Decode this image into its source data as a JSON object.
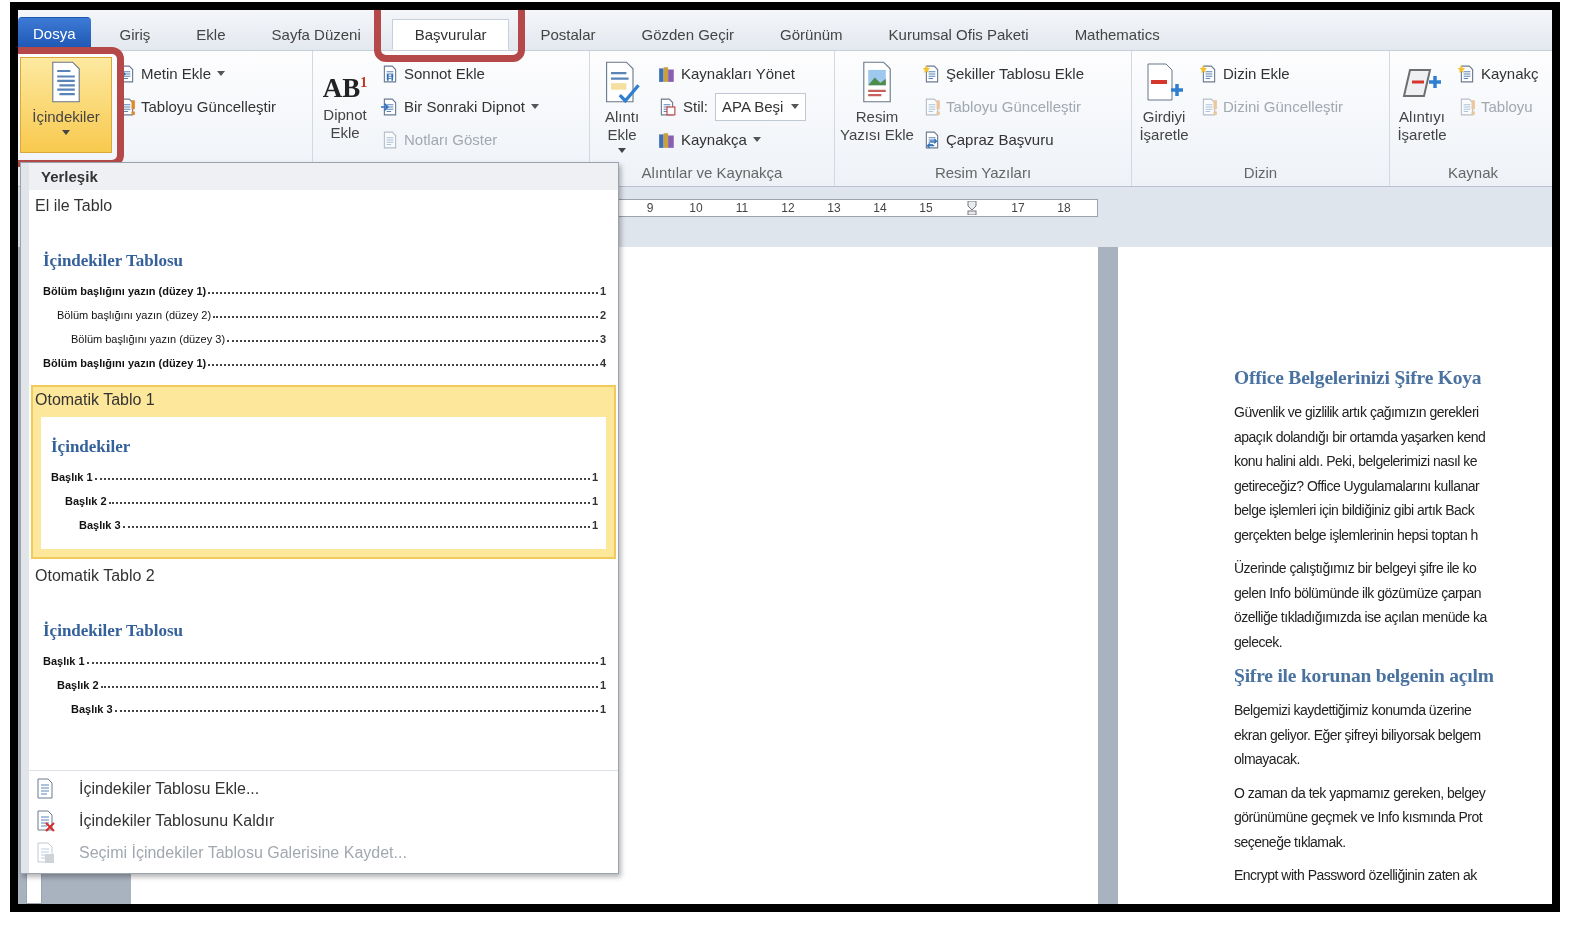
{
  "tabs": [
    {
      "label": "Dosya",
      "kind": "file",
      "selected": false
    },
    {
      "label": "Giriş",
      "kind": "tab",
      "selected": false
    },
    {
      "label": "Ekle",
      "kind": "tab",
      "selected": false
    },
    {
      "label": "Sayfa Düzeni",
      "kind": "tab",
      "selected": false
    },
    {
      "label": "Başvurular",
      "kind": "tab",
      "selected": true,
      "annotated": true
    },
    {
      "label": "Postalar",
      "kind": "tab",
      "selected": false
    },
    {
      "label": "Gözden Geçir",
      "kind": "tab",
      "selected": false
    },
    {
      "label": "Görünüm",
      "kind": "tab",
      "selected": false
    },
    {
      "label": "Kurumsal Ofis Paketi",
      "kind": "tab",
      "selected": false
    },
    {
      "label": "Mathematics",
      "kind": "tab",
      "selected": false
    }
  ],
  "ribbon": {
    "groups": [
      {
        "large": {
          "label": "İçindekiler",
          "dropdown": true,
          "active": true,
          "annotated": true
        },
        "small": [
          {
            "label": "Metin Ekle",
            "kind": "dropdown",
            "disabled": false
          },
          {
            "label": "Tabloyu Güncelleştir",
            "kind": "button",
            "disabled": false
          }
        ]
      },
      {
        "large": {
          "label": "Dipnot\nEkle",
          "icon_text": "AB$^{1}$",
          "active": false
        },
        "small": [
          {
            "label": "Sonnot Ekle",
            "kind": "button",
            "disabled": false
          },
          {
            "label": "Bir Sonraki Dipnot",
            "kind": "dropdown",
            "disabled": false
          },
          {
            "label": "Notları Göster",
            "kind": "button",
            "disabled": true
          }
        ]
      },
      {
        "label": "Alıntılar ve Kaynakça",
        "large": {
          "label": "Alıntı\nEkle",
          "dropdown": true,
          "active": false
        },
        "small": [
          {
            "label": "Kaynakları Yönet",
            "kind": "button",
            "disabled": false
          },
          {
            "label": "Stil:",
            "kind": "select",
            "value": "APA Beşi",
            "disabled": false
          },
          {
            "label": "Kaynakça",
            "kind": "dropdown",
            "disabled": false
          }
        ]
      },
      {
        "label": "Resim Yazıları",
        "large": {
          "label": "Resim\nYazısı Ekle",
          "active": false
        },
        "small": [
          {
            "label": "Şekiller Tablosu Ekle",
            "kind": "button",
            "disabled": false
          },
          {
            "label": "Tabloyu Güncelleştir",
            "kind": "button",
            "disabled": true
          },
          {
            "label": "Çapraz Başvuru",
            "kind": "button",
            "disabled": false
          }
        ]
      },
      {
        "label": "Dizin",
        "large": {
          "label": "Girdiyi\nİşaretle",
          "active": false
        },
        "small": [
          {
            "label": "Dizin Ekle",
            "kind": "button",
            "disabled": false
          },
          {
            "label": "Dizini Güncelleştir",
            "kind": "button",
            "disabled": true
          }
        ]
      },
      {
        "label": "Kaynak",
        "large": {
          "label": "Alıntıyı\nİşaretle",
          "active": false
        },
        "small": [
          {
            "label": "Kaynakç",
            "kind": "button",
            "disabled": false
          },
          {
            "label": "Tabloyu",
            "kind": "button",
            "disabled": true
          }
        ]
      }
    ]
  },
  "ruler": {
    "ticks": [
      {
        "kind": "number",
        "label": "9"
      },
      {
        "kind": "number",
        "label": "10"
      },
      {
        "kind": "number",
        "label": "11"
      },
      {
        "kind": "number",
        "label": "12"
      },
      {
        "kind": "number",
        "label": "13"
      },
      {
        "kind": "number",
        "label": "14"
      },
      {
        "kind": "number",
        "label": "15"
      },
      {
        "kind": "marker"
      },
      {
        "kind": "number",
        "label": "17"
      },
      {
        "kind": "number",
        "label": "18"
      }
    ]
  },
  "toc_menu": {
    "section": "Yerleşik",
    "gallery": [
      {
        "title": "El ile Tablo",
        "selected": false,
        "preview_title": "İçindekiler Tablosu",
        "entries": [
          {
            "text": "Bölüm başlığını yazın (düzey 1)",
            "page": "1",
            "bold": true,
            "children": [
              {
                "text": "Bölüm başlığını yazın (düzey 2)",
                "page": "2",
                "bold": false,
                "children": [
                  {
                    "text": "Bölüm başlığını yazın (düzey 3)",
                    "page": "3",
                    "bold": false
                  }
                ]
              }
            ]
          },
          {
            "text": "Bölüm başlığını yazın (düzey 1)",
            "page": "4",
            "bold": true
          }
        ]
      },
      {
        "title": "Otomatik Tablo 1",
        "selected": true,
        "preview_title": "İçindekiler",
        "entries": [
          {
            "text": "Başlık 1",
            "page": "1",
            "bold": true,
            "children": [
              {
                "text": "Başlık 2",
                "page": "1",
                "bold": true,
                "children": [
                  {
                    "text": "Başlık 3",
                    "page": "1",
                    "bold": true
                  }
                ]
              }
            ]
          }
        ]
      },
      {
        "title": "Otomatik Tablo 2",
        "selected": false,
        "preview_title": "İçindekiler Tablosu",
        "entries": [
          {
            "text": "Başlık 1",
            "page": "1",
            "bold": true,
            "children": [
              {
                "text": "Başlık 2",
                "page": "1",
                "bold": true,
                "children": [
                  {
                    "text": "Başlık 3",
                    "page": "1",
                    "bold": true
                  }
                ]
              }
            ]
          }
        ]
      }
    ],
    "commands": [
      {
        "label": "İçindekiler Tablosu Ekle...",
        "disabled": false
      },
      {
        "label": "İçindekiler Tablosunu Kaldır",
        "disabled": false
      },
      {
        "label": "Seçimi İçindekiler Tablosu Galerisine Kaydet...",
        "disabled": true
      }
    ]
  },
  "document": {
    "blocks": [
      {
        "kind": "heading",
        "lines": [
          "Office Belgelerinizi Şifre Koya"
        ]
      },
      {
        "kind": "paragraph",
        "lines": [
          "Güvenlik ve gizlilik artık çağımızın gerekleri",
          "apaçık dolandığı bir ortamda yaşarken kend",
          "konu  halini aldı. Peki, belgelerimizi nasıl ke",
          "getireceğiz? Office Uygulamalarını kullanar",
          "belge işlemleri için bildiğiniz gibi artık Back",
          "gerçekten belge işlemlerinin hepsi toptan h"
        ]
      },
      {
        "kind": "paragraph",
        "lines": [
          "Üzerinde çalıştığımız bir belgeyi şifre ile ko",
          "gelen Info bölümünde ilk gözümüze çarpan",
          "özelliğe tıkladığımızda ise açılan menüde ka",
          "gelecek."
        ]
      },
      {
        "kind": "heading",
        "lines": [
          "Şifre ile korunan belgenin  açılm"
        ]
      },
      {
        "kind": "paragraph",
        "lines": [
          "Belgemizi kaydettiğimiz konumda üzerine",
          "ekran geliyor. Eğer şifreyi biliyorsak belgem",
          "olmayacak."
        ]
      },
      {
        "kind": "paragraph",
        "lines": [
          "O zaman da tek yapmamız gereken, belgey",
          "görünümüne geçmek ve Info kısmında Prot",
          "seçeneğe tıklamak."
        ]
      },
      {
        "kind": "paragraph",
        "lines": [
          "Encrypt with Password özelliğinin zaten ak"
        ]
      }
    ]
  }
}
